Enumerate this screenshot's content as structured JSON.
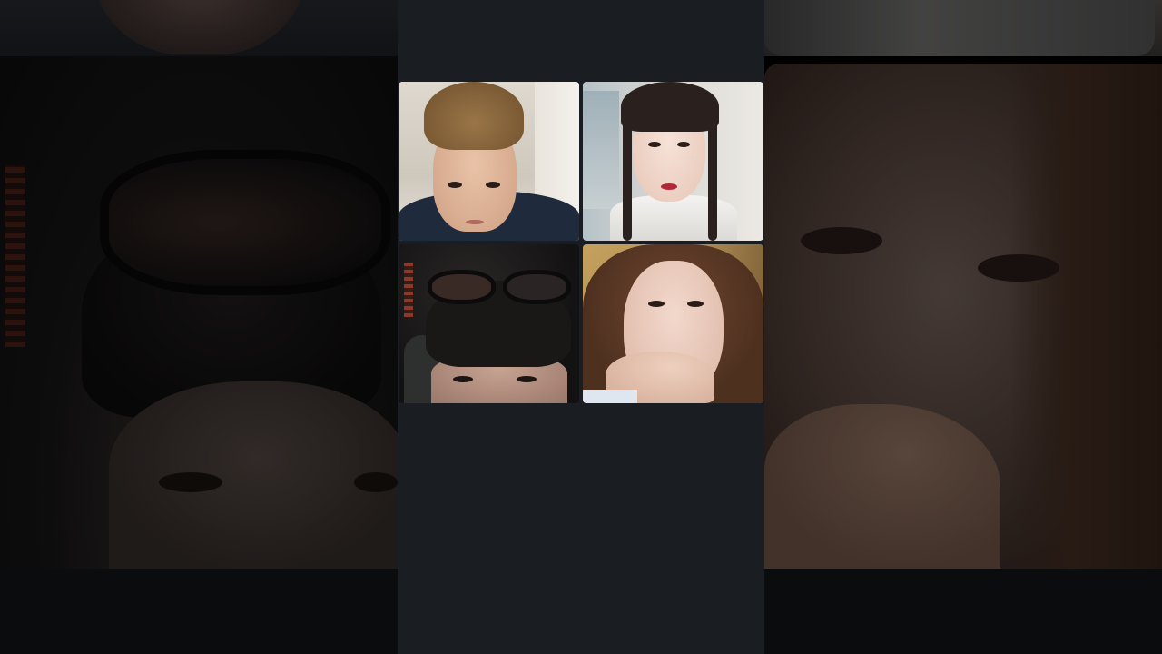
{
  "call": {
    "layout": "2x2 video grid",
    "participants": [
      {
        "id": "p1",
        "tile_color": "#ded8cf"
      },
      {
        "id": "p2",
        "tile_color": "#e6e3de"
      },
      {
        "id": "p3",
        "tile_color": "#161515"
      },
      {
        "id": "p4",
        "tile_color": "#b48f52"
      }
    ]
  },
  "colors": {
    "phone_background": "#1a1d21",
    "backdrop_bottom_bar": "#0b0c0e"
  }
}
